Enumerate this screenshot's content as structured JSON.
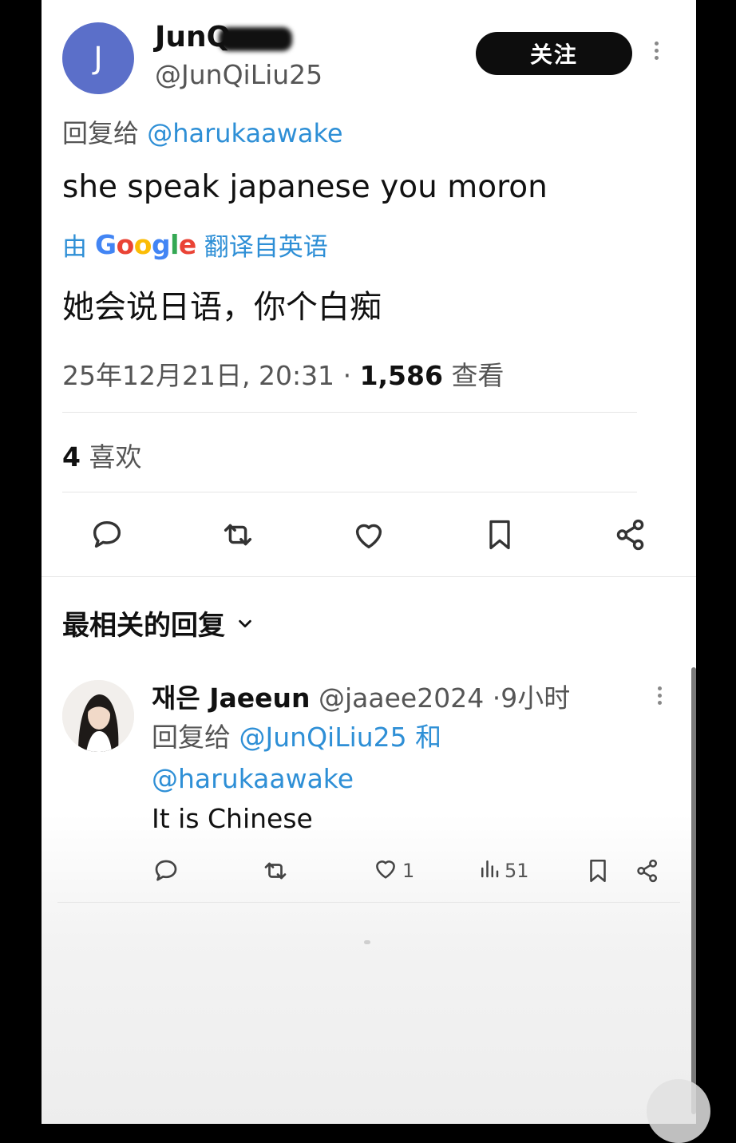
{
  "tweet": {
    "avatar_letter": "J",
    "name_visible": "JunQ",
    "handle": "@JunQiLiu25",
    "follow_label": "关注",
    "reply_to_label": "回复给",
    "reply_to_handle": "@harukaawake",
    "text": "she speak japanese you moron",
    "translate_prefix": "由",
    "translate_brand": "Google",
    "translate_suffix": "翻译自英语",
    "translated_text": "她会说日语，你个白痴",
    "timestamp": "25年12月21日, 20:31",
    "separator": "·",
    "views_count": "1,586",
    "views_label": "查看",
    "likes_count": "4",
    "likes_label": "喜欢"
  },
  "replies_section": {
    "sort_label": "最相关的回复"
  },
  "reply": {
    "name": "재은 Jaeeun",
    "handle": "@jaaee2024",
    "separator": "·",
    "time": "9小时",
    "reply_to_label": "回复给",
    "reply_to_handle_1": "@JunQiLiu25",
    "and_label": "和",
    "reply_to_handle_2": "@harukaawake",
    "text": "It is Chinese",
    "like_count": "1",
    "view_count": "51"
  },
  "colors": {
    "link": "#2e8fd6",
    "avatar": "#5b6fc9",
    "follow_bg": "#0d0d0d"
  },
  "icons": [
    "more-icon",
    "reply-icon",
    "retweet-icon",
    "like-icon",
    "bookmark-icon",
    "share-icon",
    "chevron-down-icon",
    "views-icon"
  ]
}
